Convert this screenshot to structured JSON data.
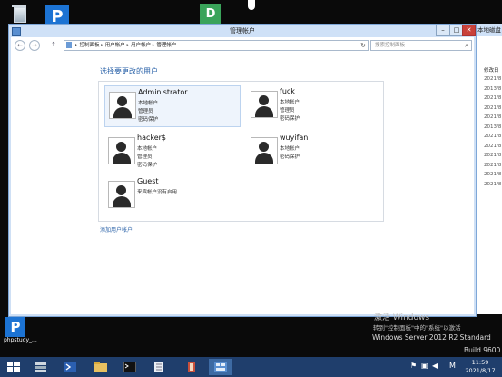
{
  "window": {
    "title": "管理帐户",
    "controls": {
      "minimize": "–",
      "maximize": "□",
      "close": "✕"
    }
  },
  "nav": {
    "back": "←",
    "forward": "→",
    "up": "↑"
  },
  "address": {
    "crumbs": [
      "控制面板",
      "用户帐户",
      "用户帐户",
      "管理帐户"
    ],
    "separator": "▸",
    "refresh": "↻"
  },
  "search": {
    "placeholder": "搜索控制面板",
    "icon": "⌕"
  },
  "heading": "选择要更改的用户",
  "accounts": [
    {
      "name": "Administrator",
      "lines": [
        "本地帐户",
        "管理员",
        "密码保护"
      ]
    },
    {
      "name": "fuck",
      "lines": [
        "本地帐户",
        "管理员",
        "密码保护"
      ]
    },
    {
      "name": "hacker$",
      "lines": [
        "本地帐户",
        "管理员",
        "密码保护"
      ]
    },
    {
      "name": "wuyifan",
      "lines": [
        "本地帐户",
        "密码保护"
      ]
    },
    {
      "name": "Guest",
      "lines": [
        "来宾帐户没有启用"
      ]
    }
  ],
  "add_user_link": "添加用户帐户",
  "desktop": {
    "phpstudy_label": "phpstudy_..."
  },
  "background_window": {
    "title": "本地磁盘",
    "column": "修改日",
    "dates": [
      "2021/8",
      "2013/8",
      "2021/8",
      "2021/8",
      "2021/8",
      "2013/8",
      "2021/8",
      "2021/8",
      "2021/8",
      "2021/8",
      "2021/8",
      "2021/8"
    ]
  },
  "watermark": {
    "line1": "激活 Windows",
    "line2": "转到\"控制面板\"中的\"系统\"以激活",
    "line3": "Windows Server 2012 R2 Standard",
    "line4": "Build 9600"
  },
  "tray": {
    "time": "11:59",
    "date": "2021/8/17",
    "ime": "M"
  },
  "colors": {
    "taskbar": "#1f3e6c",
    "link": "#2a62a8",
    "title_bar": "#cfe1f7"
  }
}
